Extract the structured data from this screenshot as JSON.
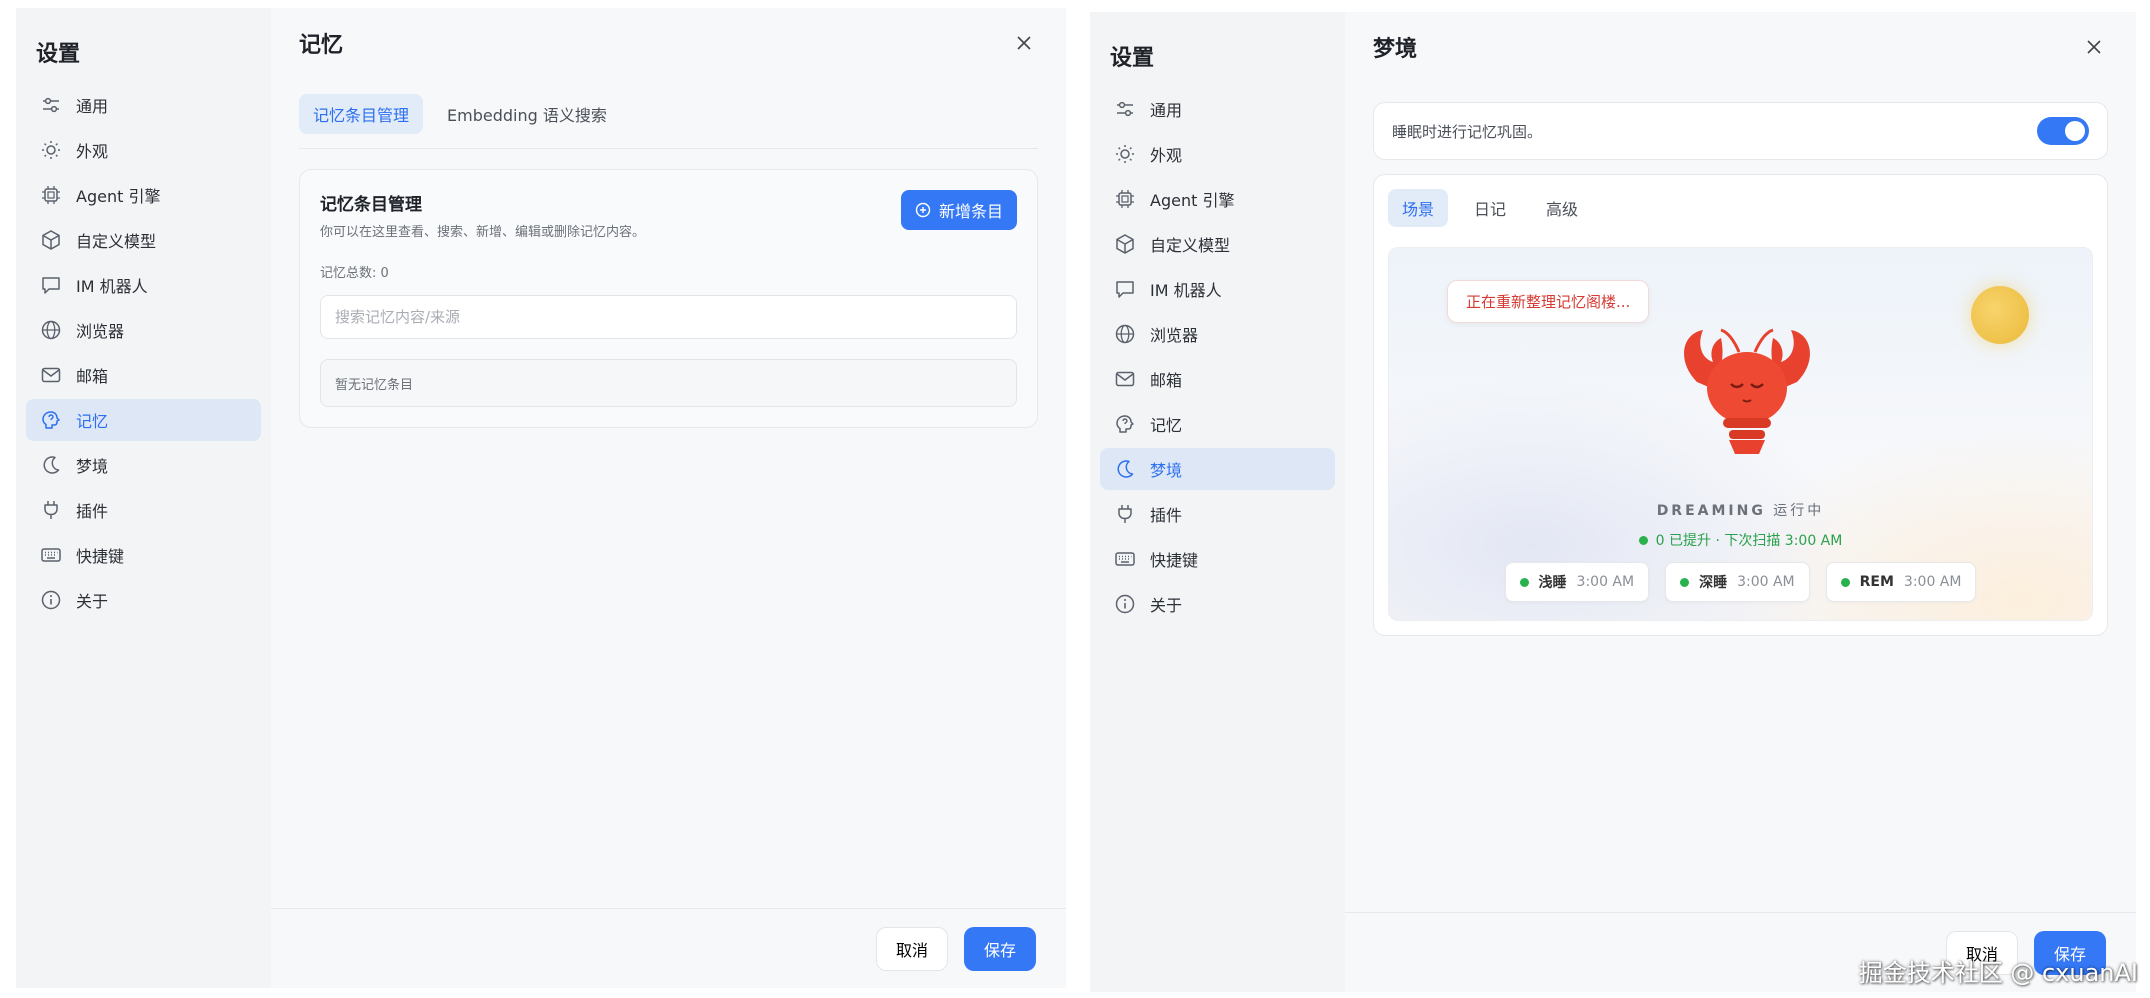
{
  "left": {
    "sidebar": {
      "title": "设置",
      "items": [
        {
          "label": "通用",
          "icon": "sliders-icon"
        },
        {
          "label": "外观",
          "icon": "sun-icon"
        },
        {
          "label": "Agent 引擎",
          "icon": "chip-icon"
        },
        {
          "label": "自定义模型",
          "icon": "cube-icon"
        },
        {
          "label": "IM 机器人",
          "icon": "chat-bubble-icon"
        },
        {
          "label": "浏览器",
          "icon": "globe-icon"
        },
        {
          "label": "邮箱",
          "icon": "mail-icon"
        },
        {
          "label": "记忆",
          "icon": "brain-icon",
          "active": true
        },
        {
          "label": "梦境",
          "icon": "moon-icon"
        },
        {
          "label": "插件",
          "icon": "plug-icon"
        },
        {
          "label": "快捷键",
          "icon": "keyboard-icon"
        },
        {
          "label": "关于",
          "icon": "info-icon"
        }
      ]
    },
    "main": {
      "title": "记忆",
      "tabs": [
        "记忆条目管理",
        "Embedding 语义搜索"
      ],
      "card": {
        "title": "记忆条目管理",
        "desc": "你可以在这里查看、搜索、新增、编辑或删除记忆内容。",
        "add_label": "新增条目",
        "count": "记忆总数: 0",
        "search_placeholder": "搜索记忆内容/来源",
        "empty": "暂无记忆条目"
      }
    },
    "footer": {
      "cancel": "取消",
      "save": "保存"
    }
  },
  "right": {
    "sidebar": {
      "title": "设置",
      "active_label": "梦境"
    },
    "main": {
      "title": "梦境",
      "toggle_label": "睡眠时进行记忆巩固。",
      "toggle_on": true,
      "tabs": [
        "场景",
        "日记",
        "高级"
      ],
      "scene": {
        "bubble": "正在重新整理记忆阁楼...",
        "state_word": "DREAMING",
        "state_text": "运行中",
        "status": "0 已提升 · 下次扫描 3:00 AM",
        "phases": [
          {
            "name": "浅睡",
            "time": "3:00 AM"
          },
          {
            "name": "深睡",
            "time": "3:00 AM"
          },
          {
            "name": "REM",
            "time": "3:00 AM"
          }
        ]
      }
    },
    "footer": {
      "cancel": "取消",
      "save": "保存"
    }
  },
  "watermark": "掘金技术社区 @ cxuanAI",
  "colors": {
    "accent": "#3478f6",
    "active_bg": "#dde7f6",
    "danger": "#d63a32",
    "success": "#28b14c"
  }
}
